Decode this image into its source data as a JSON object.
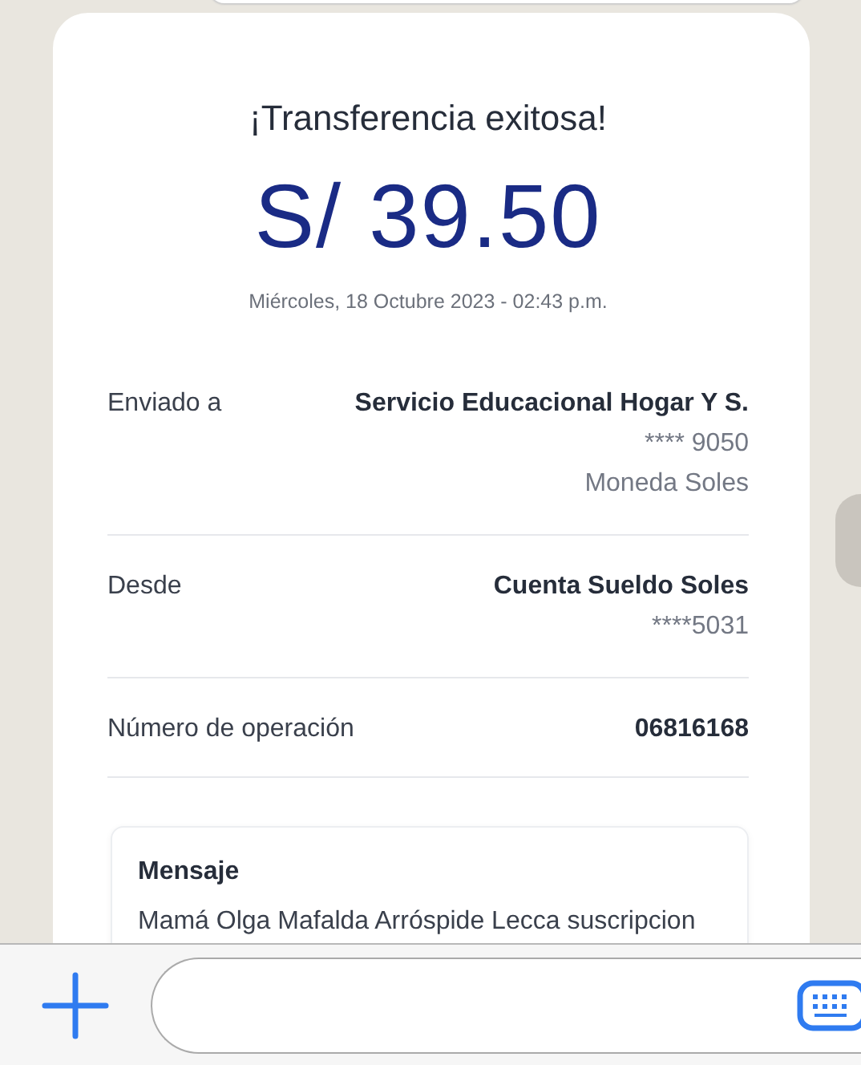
{
  "receipt": {
    "title": "¡Transferencia exitosa!",
    "amount": "S/ 39.50",
    "datetime": "Miércoles, 18 Octubre 2023 - 02:43 p.m.",
    "details": [
      {
        "label": "Enviado a",
        "values": [
          {
            "kind": "main",
            "text": "Servicio Educacional Hogar Y S."
          },
          {
            "kind": "sub",
            "text": "**** 9050"
          },
          {
            "kind": "sub",
            "text": "Moneda Soles"
          }
        ]
      },
      {
        "label": "Desde",
        "values": [
          {
            "kind": "main",
            "text": "Cuenta Sueldo Soles"
          },
          {
            "kind": "sub",
            "text": "****5031"
          }
        ]
      },
      {
        "label": "Número de operación",
        "values": [
          {
            "kind": "main",
            "text": "06816168"
          }
        ]
      }
    ],
    "message": {
      "heading": "Mensaje",
      "text": "Mamá Olga Mafalda Arróspide Lecca suscripcion"
    }
  }
}
